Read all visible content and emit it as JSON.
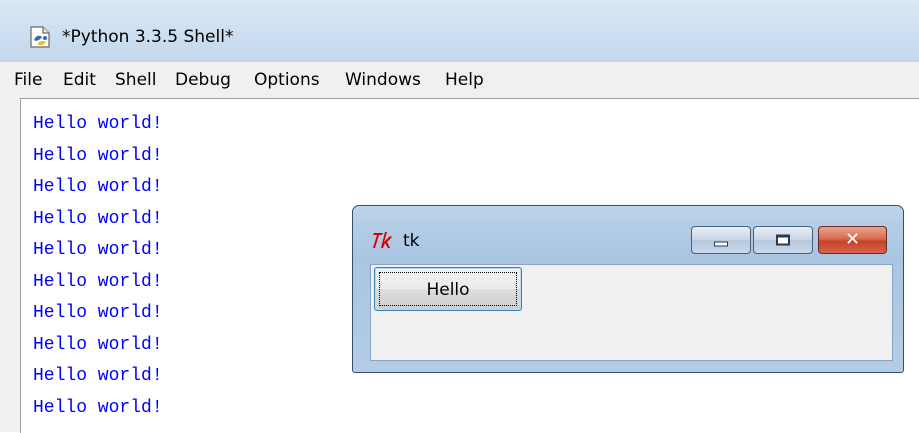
{
  "shell": {
    "title": "*Python 3.3.5 Shell*",
    "menu": [
      "File",
      "Edit",
      "Shell",
      "Debug",
      "Options",
      "Windows",
      "Help"
    ],
    "output_lines": [
      "Hello world!",
      "Hello world!",
      "Hello world!",
      "Hello world!",
      "Hello world!",
      "Hello world!",
      "Hello world!",
      "Hello world!",
      "Hello world!",
      "Hello world!"
    ],
    "output_color": "#0000ff"
  },
  "tk_window": {
    "title": "tk",
    "button_label": "Hello",
    "icon": "tk-feather-icon",
    "close_color": "#c4432a"
  }
}
